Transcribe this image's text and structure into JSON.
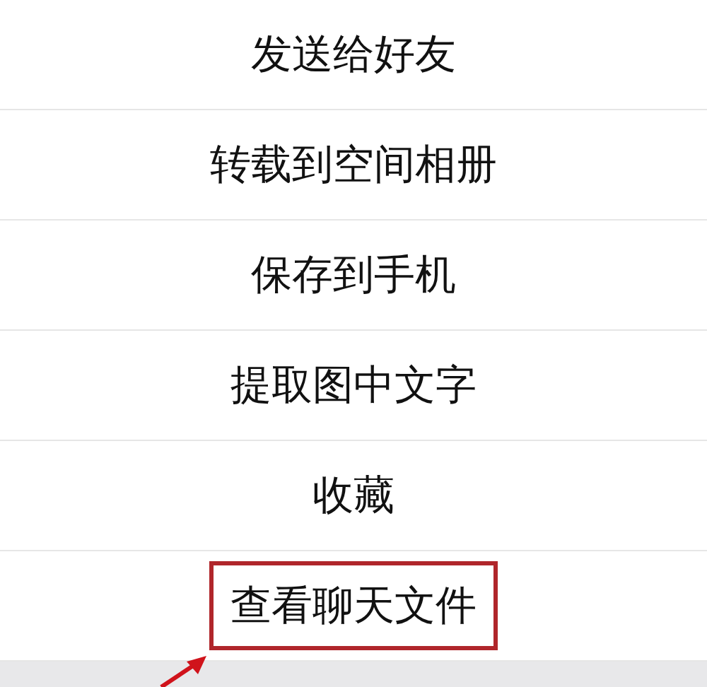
{
  "menu": {
    "items": [
      {
        "label": "发送给好友",
        "highlighted": false
      },
      {
        "label": "转载到空间相册",
        "highlighted": false
      },
      {
        "label": "保存到手机",
        "highlighted": false
      },
      {
        "label": "提取图中文字",
        "highlighted": false
      },
      {
        "label": "收藏",
        "highlighted": false
      },
      {
        "label": "查看聊天文件",
        "highlighted": true
      }
    ]
  }
}
